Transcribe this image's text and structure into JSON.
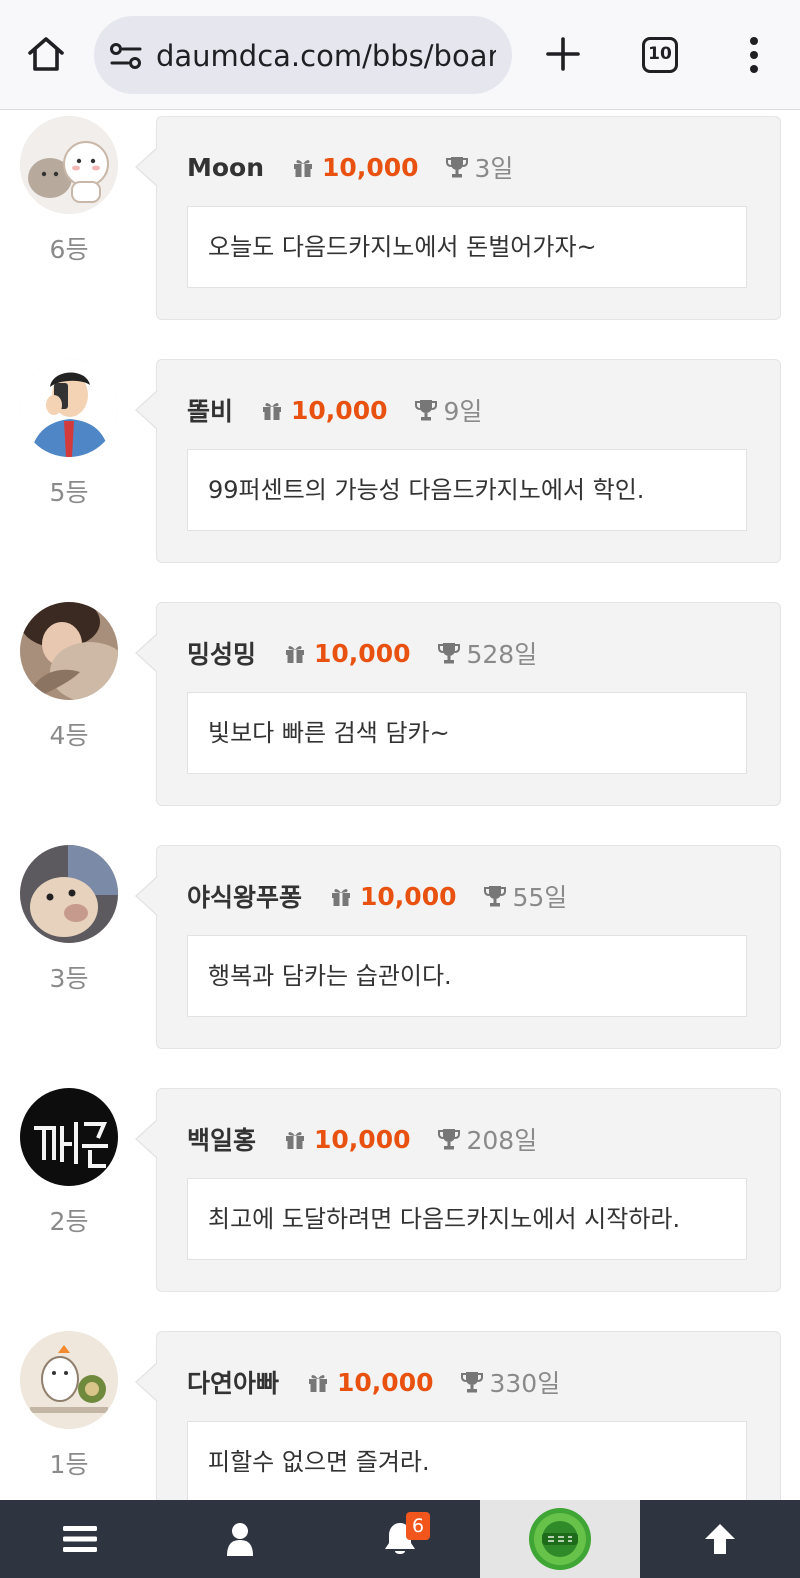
{
  "browser": {
    "url": "daumdca.com/bbs/board",
    "tab_count": "10"
  },
  "colors": {
    "points": "#e8510f",
    "nav_background": "#2f3540",
    "badge": "#f2561d"
  },
  "comments": [
    {
      "rank": "6등",
      "nick": "Moon",
      "points": "10,000",
      "days": "3일",
      "message": "오늘도 다음드카지노에서 돈벌어가자~",
      "avatar_icon": "cartoon-cats-avatar"
    },
    {
      "rank": "5등",
      "nick": "똘비",
      "points": "10,000",
      "days": "9일",
      "message": "99퍼센트의 가능성 다음드카지노에서 학인.",
      "avatar_icon": "businessman-phone-avatar"
    },
    {
      "rank": "4등",
      "nick": "밍성밍",
      "points": "10,000",
      "days": "528일",
      "message": "빛보다 빠른 검색 담카~",
      "avatar_icon": "woman-photo-avatar"
    },
    {
      "rank": "3등",
      "nick": "야식왕푸퐁",
      "points": "10,000",
      "days": "55일",
      "message": "행복과 담카는 습관이다.",
      "avatar_icon": "dog-photo-avatar"
    },
    {
      "rank": "2등",
      "nick": "백일홍",
      "points": "10,000",
      "days": "208일",
      "message": "최고에 도달하려면 다음드카지노에서 시작하라.",
      "avatar_icon": "neon-sign-avatar"
    },
    {
      "rank": "1등",
      "nick": "다연아빠",
      "points": "10,000",
      "days": "330일",
      "message": "피할수 없으면 즐겨라.",
      "avatar_icon": "hamster-cartoon-avatar"
    }
  ],
  "bottom_nav": {
    "notification_count": "6",
    "items": [
      "menu-icon",
      "user-icon",
      "bell-icon",
      "daumd-casino-logo",
      "arrow-up-icon"
    ]
  }
}
